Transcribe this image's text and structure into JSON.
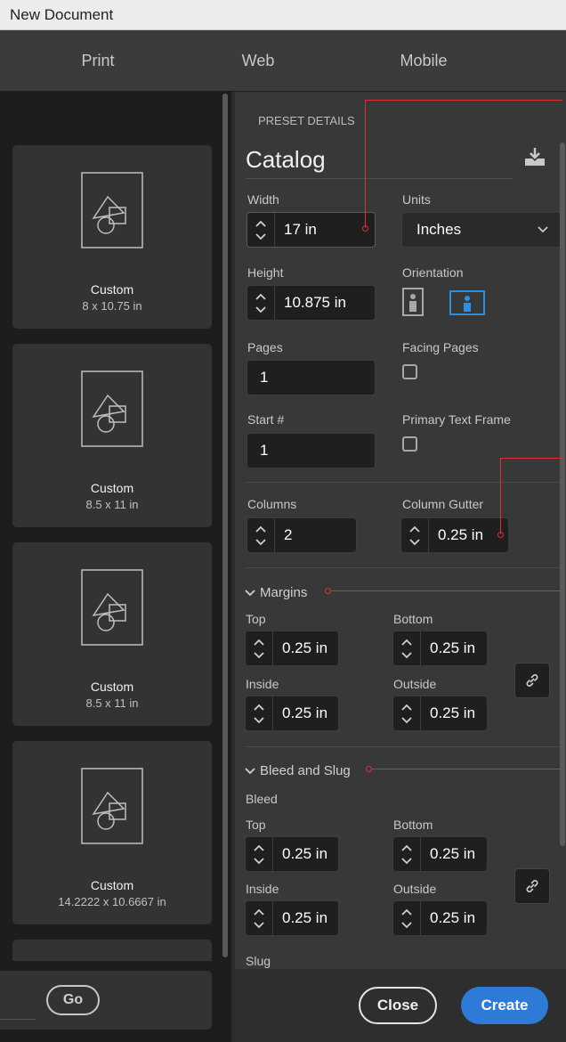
{
  "window": {
    "title": "New Document"
  },
  "tabs": [
    {
      "label": "Print"
    },
    {
      "label": "Web"
    },
    {
      "label": "Mobile"
    }
  ],
  "presets": [
    {
      "name": "Custom",
      "size": "8 x 10.75 in"
    },
    {
      "name": "Custom",
      "size": "8.5 x 11 in"
    },
    {
      "name": "Custom",
      "size": "8.5 x 11 in"
    },
    {
      "name": "Custom",
      "size": "14.2222 x 10.6667 in"
    }
  ],
  "search": {
    "go_label": "Go"
  },
  "details": {
    "header": "PRESET DETAILS",
    "preset_name": "Catalog",
    "width": {
      "label": "Width",
      "value": "17 in"
    },
    "units": {
      "label": "Units",
      "value": "Inches"
    },
    "height": {
      "label": "Height",
      "value": "10.875 in"
    },
    "orientation": {
      "label": "Orientation",
      "selected": "landscape"
    },
    "pages": {
      "label": "Pages",
      "value": "1"
    },
    "facing_pages": {
      "label": "Facing Pages",
      "checked": false
    },
    "start": {
      "label": "Start #",
      "value": "1"
    },
    "primary_text_frame": {
      "label": "Primary Text Frame",
      "checked": false
    },
    "columns": {
      "label": "Columns",
      "value": "2"
    },
    "column_gutter": {
      "label": "Column Gutter",
      "value": "0.25 in"
    }
  },
  "margins": {
    "title": "Margins",
    "top": {
      "label": "Top",
      "value": "0.25 in"
    },
    "bottom": {
      "label": "Bottom",
      "value": "0.25 in"
    },
    "inside": {
      "label": "Inside",
      "value": "0.25 in"
    },
    "outside": {
      "label": "Outside",
      "value": "0.25 in"
    }
  },
  "bleed_slug": {
    "title": "Bleed and Slug",
    "bleed_label": "Bleed",
    "top": {
      "label": "Top",
      "value": "0.25 in"
    },
    "bottom": {
      "label": "Bottom",
      "value": "0.25 in"
    },
    "inside": {
      "label": "Inside",
      "value": "0.25 in"
    },
    "outside": {
      "label": "Outside",
      "value": "0.25 in"
    },
    "slug_label": "Slug"
  },
  "actions": {
    "close_label": "Close",
    "create_label": "Create"
  },
  "colors": {
    "accent": "#2d7bd6",
    "annotation": "#d93030"
  },
  "icons": [
    "save-preset-icon",
    "chevron-down-icon",
    "portrait-icon",
    "landscape-icon",
    "link-icon",
    "spinner-arrows-icon",
    "document-shapes-icon"
  ]
}
